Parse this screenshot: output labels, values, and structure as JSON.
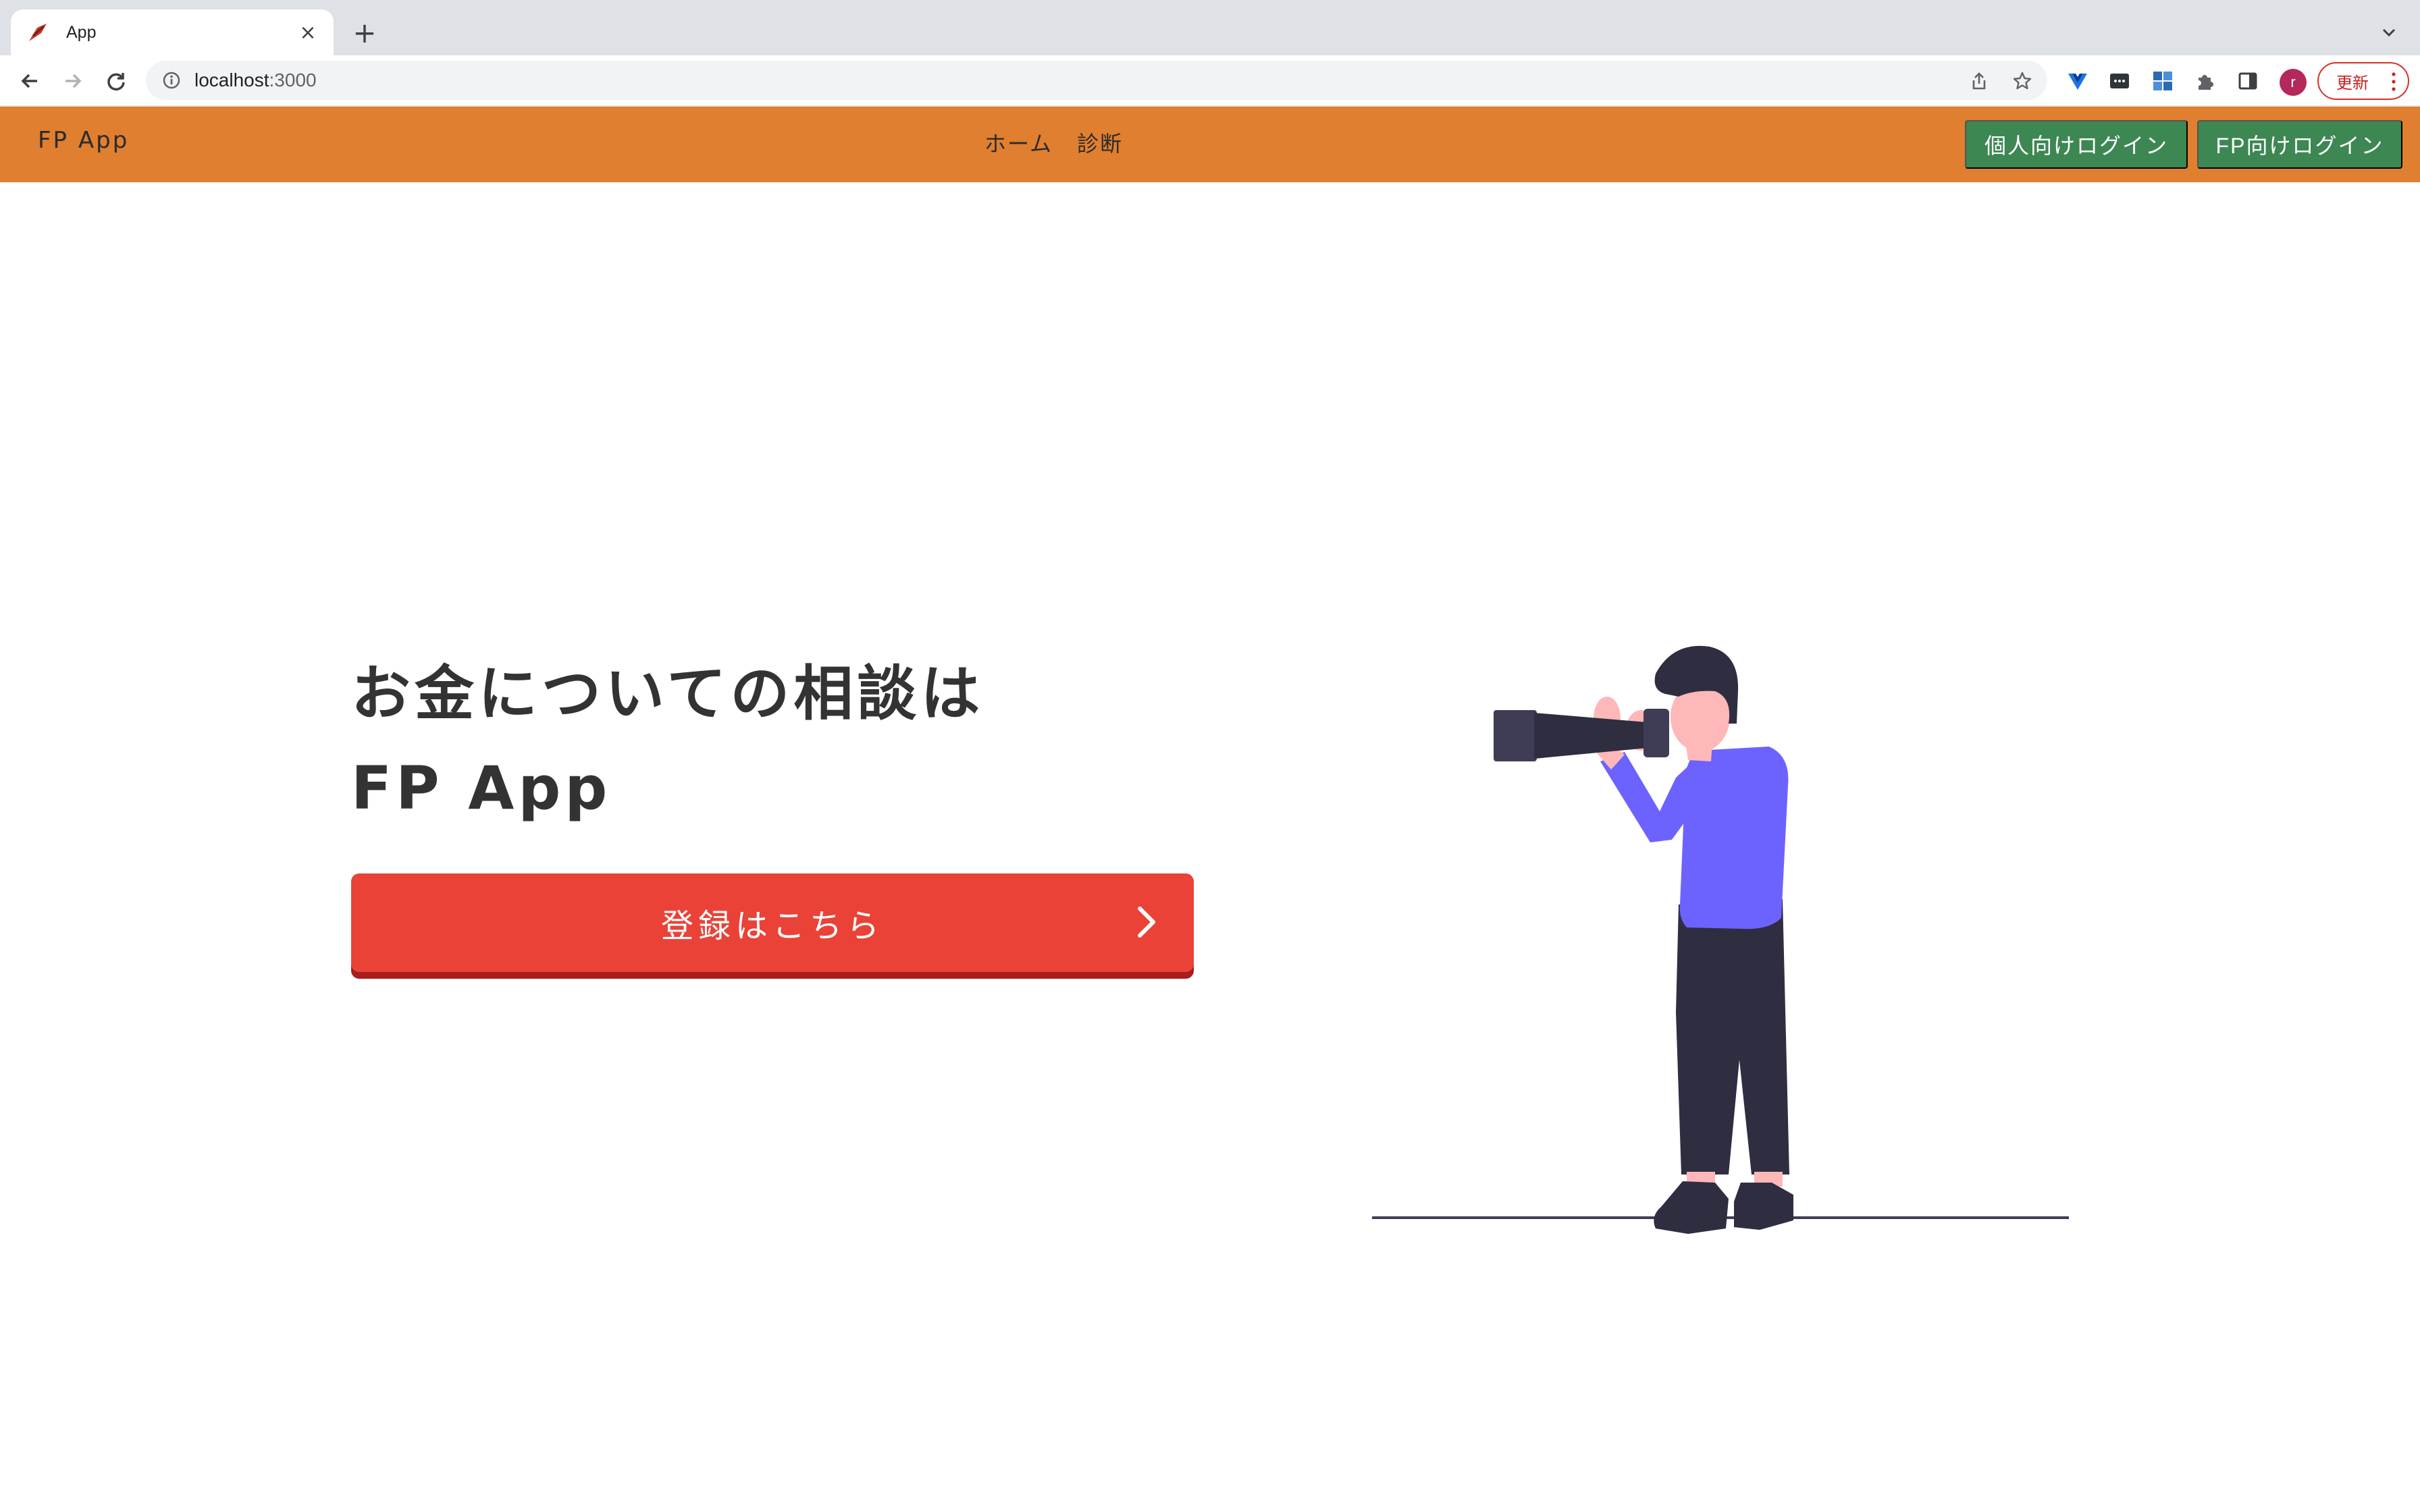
{
  "browser": {
    "tab_title": "App",
    "tab_close": "×",
    "new_tab": "+",
    "url_host": "localhost",
    "url_port": ":3000",
    "profile_initial": "r",
    "update_label": "更新"
  },
  "nav": {
    "brand": "FP App",
    "links": [
      "ホーム",
      "診断"
    ],
    "login_personal": "個人向けログイン",
    "login_fp": "FP向けログイン"
  },
  "hero": {
    "title_line1": "お金についての相談は",
    "title_line2": "FP App",
    "cta_label": "登録はこちら"
  },
  "colors": {
    "navbar": "#e07f2f",
    "login_button": "#3d8753",
    "cta": "#ea4237",
    "illustration_accent": "#6c63ff"
  },
  "icons": [
    "back-arrow-icon",
    "forward-arrow-icon",
    "reload-icon",
    "info-icon",
    "share-icon",
    "star-icon",
    "extension-icon",
    "side-panel-icon",
    "chevron-right-icon",
    "more-vert-icon"
  ]
}
